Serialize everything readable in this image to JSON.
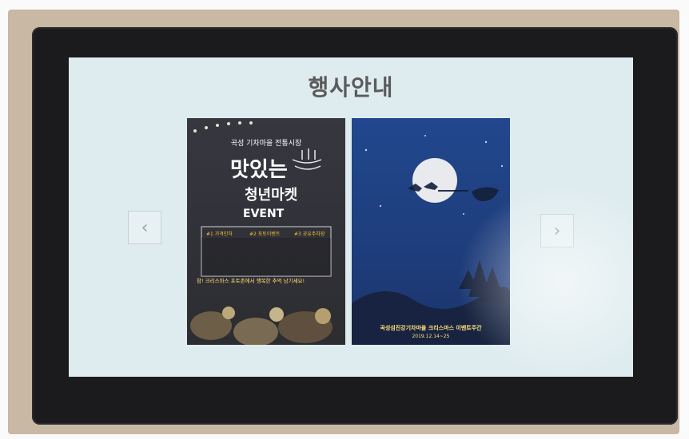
{
  "screen": {
    "title": "행사안내",
    "nav": {
      "prev_icon": "chevron-left-icon",
      "next_icon": "chevron-right-icon"
    }
  },
  "posters": [
    {
      "name": "poster-market",
      "top_text": "곡성 기차마을 전통시장",
      "headline_1": "맛있는",
      "headline_2": "청년마켓",
      "event_label": "EVENT",
      "event_items": [
        "#1 가격인하",
        "#2 포토이벤트",
        "#3 공유주차장"
      ],
      "notice": "참! 크리스마스 포토존에서 행복한 추억 남기세요!",
      "colors": {
        "background": "#2a2a32",
        "accent": "#f1c232"
      }
    },
    {
      "name": "poster-christmas",
      "caption": "곡성섬진강기차마을 크리스마스 이벤트주간",
      "date": "2019.12.14~25",
      "colors": {
        "background": "#163a82",
        "moon": "#f2f2f2"
      }
    }
  ]
}
